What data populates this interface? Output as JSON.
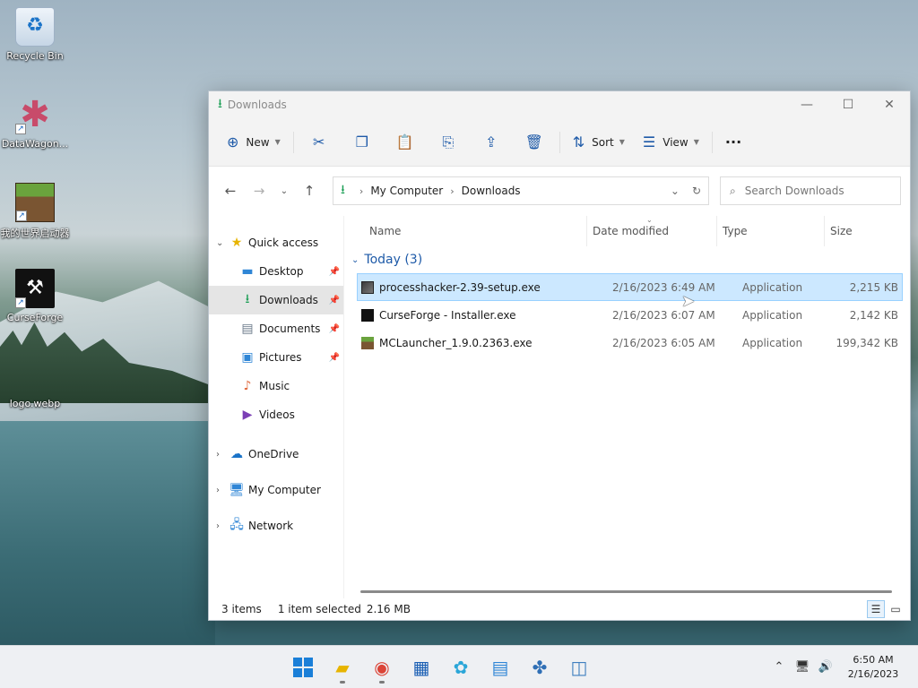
{
  "desktop": {
    "icons": [
      {
        "label": "Recycle Bin",
        "icon": "recycle-bin-icon"
      },
      {
        "label": "DataWagon...",
        "icon": "datawagon-icon"
      },
      {
        "label": "我的世界启动器",
        "icon": "minecraft-launcher-icon"
      },
      {
        "label": "CurseForge",
        "icon": "curseforge-icon"
      },
      {
        "label": "logo.webp",
        "icon": "image-file-icon"
      }
    ]
  },
  "window": {
    "title": "Downloads",
    "controls": {
      "minimize": "—",
      "maximize": "☐",
      "close": "✕"
    }
  },
  "toolbar": {
    "new_label": "New",
    "sort_label": "Sort",
    "view_label": "View",
    "more_label": "···"
  },
  "address": {
    "crumbs": [
      "My Computer",
      "Downloads"
    ],
    "search_placeholder": "Search Downloads"
  },
  "sidebar": {
    "quick_access": "Quick access",
    "items": [
      {
        "label": "Desktop",
        "icon": "desktop-icon",
        "pinned": true
      },
      {
        "label": "Downloads",
        "icon": "downloads-icon",
        "pinned": true,
        "selected": true
      },
      {
        "label": "Documents",
        "icon": "documents-icon",
        "pinned": true
      },
      {
        "label": "Pictures",
        "icon": "pictures-icon",
        "pinned": true
      },
      {
        "label": "Music",
        "icon": "music-icon",
        "pinned": false
      },
      {
        "label": "Videos",
        "icon": "videos-icon",
        "pinned": false
      }
    ],
    "roots": [
      {
        "label": "OneDrive",
        "icon": "onedrive-icon"
      },
      {
        "label": "My Computer",
        "icon": "computer-icon"
      },
      {
        "label": "Network",
        "icon": "network-icon"
      }
    ]
  },
  "files": {
    "columns": {
      "name": "Name",
      "date": "Date modified",
      "type": "Type",
      "size": "Size"
    },
    "group": "Today (3)",
    "rows": [
      {
        "name": "processhacker-2.39-setup.exe",
        "date": "2/16/2023 6:49 AM",
        "type": "Application",
        "size": "2,215 KB",
        "selected": true
      },
      {
        "name": "CurseForge - Installer.exe",
        "date": "2/16/2023 6:07 AM",
        "type": "Application",
        "size": "2,142 KB",
        "selected": false
      },
      {
        "name": "MCLauncher_1.9.0.2363.exe",
        "date": "2/16/2023 6:05 AM",
        "type": "Application",
        "size": "199,342 KB",
        "selected": false
      }
    ]
  },
  "status": {
    "count": "3 items",
    "selection": "1 item selected",
    "size": "2.16 MB"
  },
  "taskbar": {
    "apps": [
      "start-icon",
      "file-explorer-icon",
      "chrome-icon",
      "store-icon",
      "paint-icon",
      "notepad-icon",
      "teams-icon",
      "monitor-icon"
    ],
    "time": "6:50 AM",
    "date": "2/16/2023"
  },
  "colors": {
    "accent": "#1e5aa8",
    "selection": "#cce8ff",
    "downloads_green": "#1b9e55"
  }
}
